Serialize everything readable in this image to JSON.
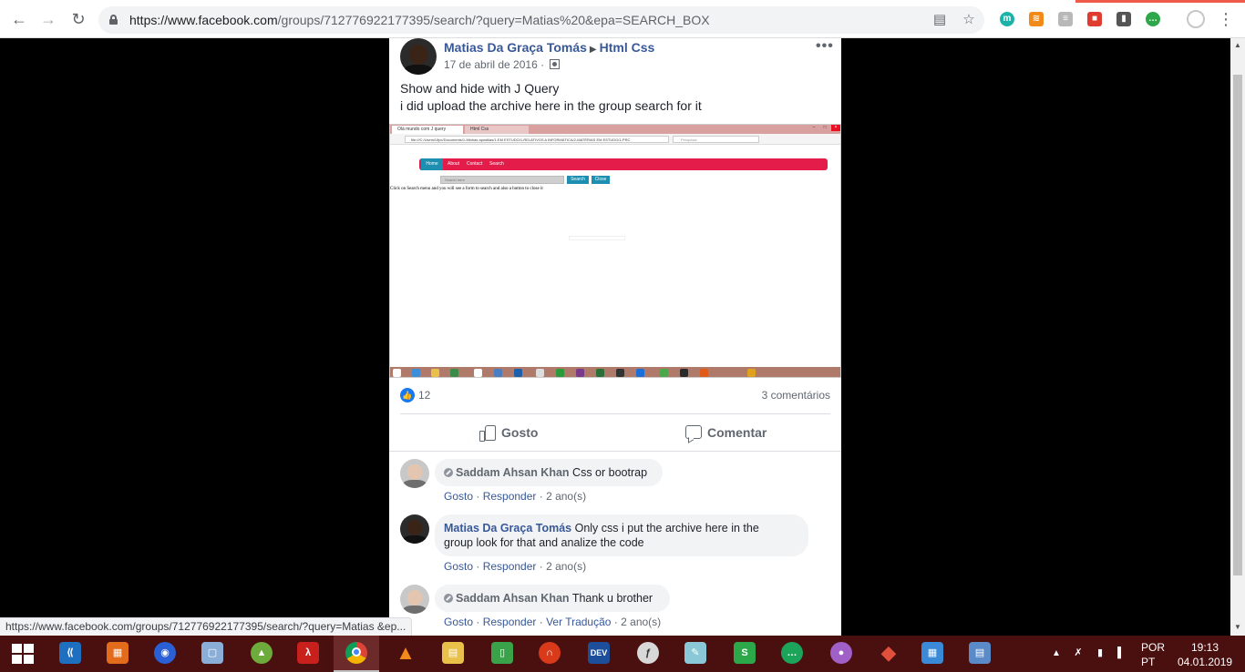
{
  "browser": {
    "url_host": "https://www.facebook.com",
    "url_path": "/groups/712776922177395/search/?query=Matias%20&epa=SEARCH_BOX",
    "status_url": "https://www.facebook.com/groups/712776922177395/search/?query=Matias &ep..."
  },
  "post": {
    "author": "Matias Da Graça Tomás",
    "group": "Html Css",
    "date": "17 de abril de 2016 ·",
    "text_line1": "Show and hide with J Query",
    "text_line2": "i did upload the archive here in the group search for it",
    "likes": "12",
    "comments_count": "3 comentários",
    "like_action": "Gosto",
    "comment_action": "Comentar"
  },
  "screenshot": {
    "tab1": "Olá mundo com J query",
    "tab2": "Html Css",
    "address": "file:///C:/Users/Ufpc/Documents/1-Minhas apostilas/1-EM ESTUDO/1-RELATIVOS A INFORMÁTICA/2-MATÉRIAS EM ESTUDO/1-PRC",
    "search_placeholder": "Pesquisar",
    "nav": [
      "Home",
      "About",
      "Contact",
      "Search"
    ],
    "input_placeholder": "Search here",
    "btn_search": "Search",
    "btn_close": "Close",
    "caption": "Click on Search menu and you will see a form to search and also a button to close it"
  },
  "comments": [
    {
      "name": "Saddam Ahsan Khan",
      "text": "Css or bootrap",
      "like": "Gosto",
      "reply": "Responder",
      "time": "2 ano(s)"
    },
    {
      "name": "Matias Da Graça Tomás",
      "text_line1": "Only css i put the archive here in the",
      "text_line2": "group look for that and analize the code",
      "like": "Gosto",
      "reply": "Responder",
      "time": "2 ano(s)"
    },
    {
      "name": "Saddam Ahsan Khan",
      "text": "Thank u brother",
      "like": "Gosto",
      "reply": "Responder",
      "translate": "Ver Tradução",
      "time": "2 ano(s)"
    }
  ],
  "taskbar": {
    "lang1": "POR",
    "lang2": "PT",
    "time": "19:13",
    "date": "04.01.2019"
  },
  "colors": {
    "fb_link": "#385898",
    "taskbar": "#4a0f0f",
    "like_blue": "#1877f2"
  }
}
